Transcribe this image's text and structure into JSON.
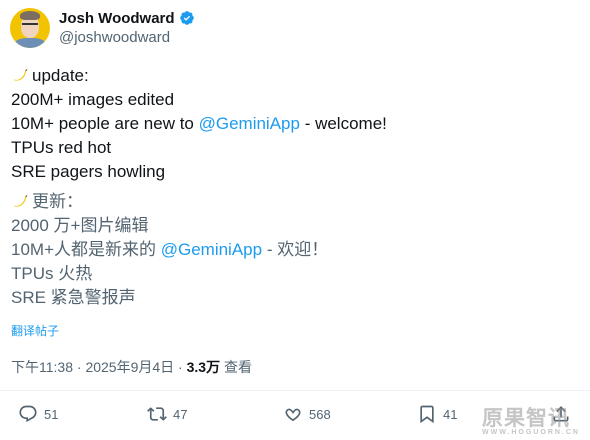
{
  "author": {
    "display_name": "Josh Woodward",
    "handle": "@joshwoodward"
  },
  "post": {
    "en_update": "update:",
    "en_line1": "200M+ images edited",
    "en_line2_prefix": "10M+ people are new to ",
    "en_line2_mention": "@GeminiApp",
    "en_line2_suffix": " - welcome!",
    "en_line3": "TPUs red hot",
    "en_line4": "SRE pagers howling",
    "zh_update": "更新：",
    "zh_line1": "2000 万+图片编辑",
    "zh_line2_prefix": "10M+人都是新来的 ",
    "zh_line2_mention": "@GeminiApp",
    "zh_line2_suffix": " - 欢迎！",
    "zh_line3": "TPUs 火热",
    "zh_line4": "SRE 紧急警报声"
  },
  "translate_label": "翻译帖子",
  "meta": {
    "time": "下午11:38",
    "separator": " · ",
    "date": "2025年9月4日",
    "views_count": "3.3万",
    "views_label": " 查看"
  },
  "actions": {
    "replies": "51",
    "reposts": "47",
    "likes": "568",
    "bookmarks": "41"
  },
  "watermark": {
    "text": "原果智讯",
    "url": "WWW.HOGUORN.CN"
  },
  "colors": {
    "accent": "#1d9bf0",
    "muted": "#536471",
    "text": "#0f1419"
  },
  "icons": [
    "verified-badge-icon",
    "banana-icon",
    "reply-icon",
    "repost-icon",
    "like-icon",
    "bookmark-icon",
    "share-icon"
  ]
}
